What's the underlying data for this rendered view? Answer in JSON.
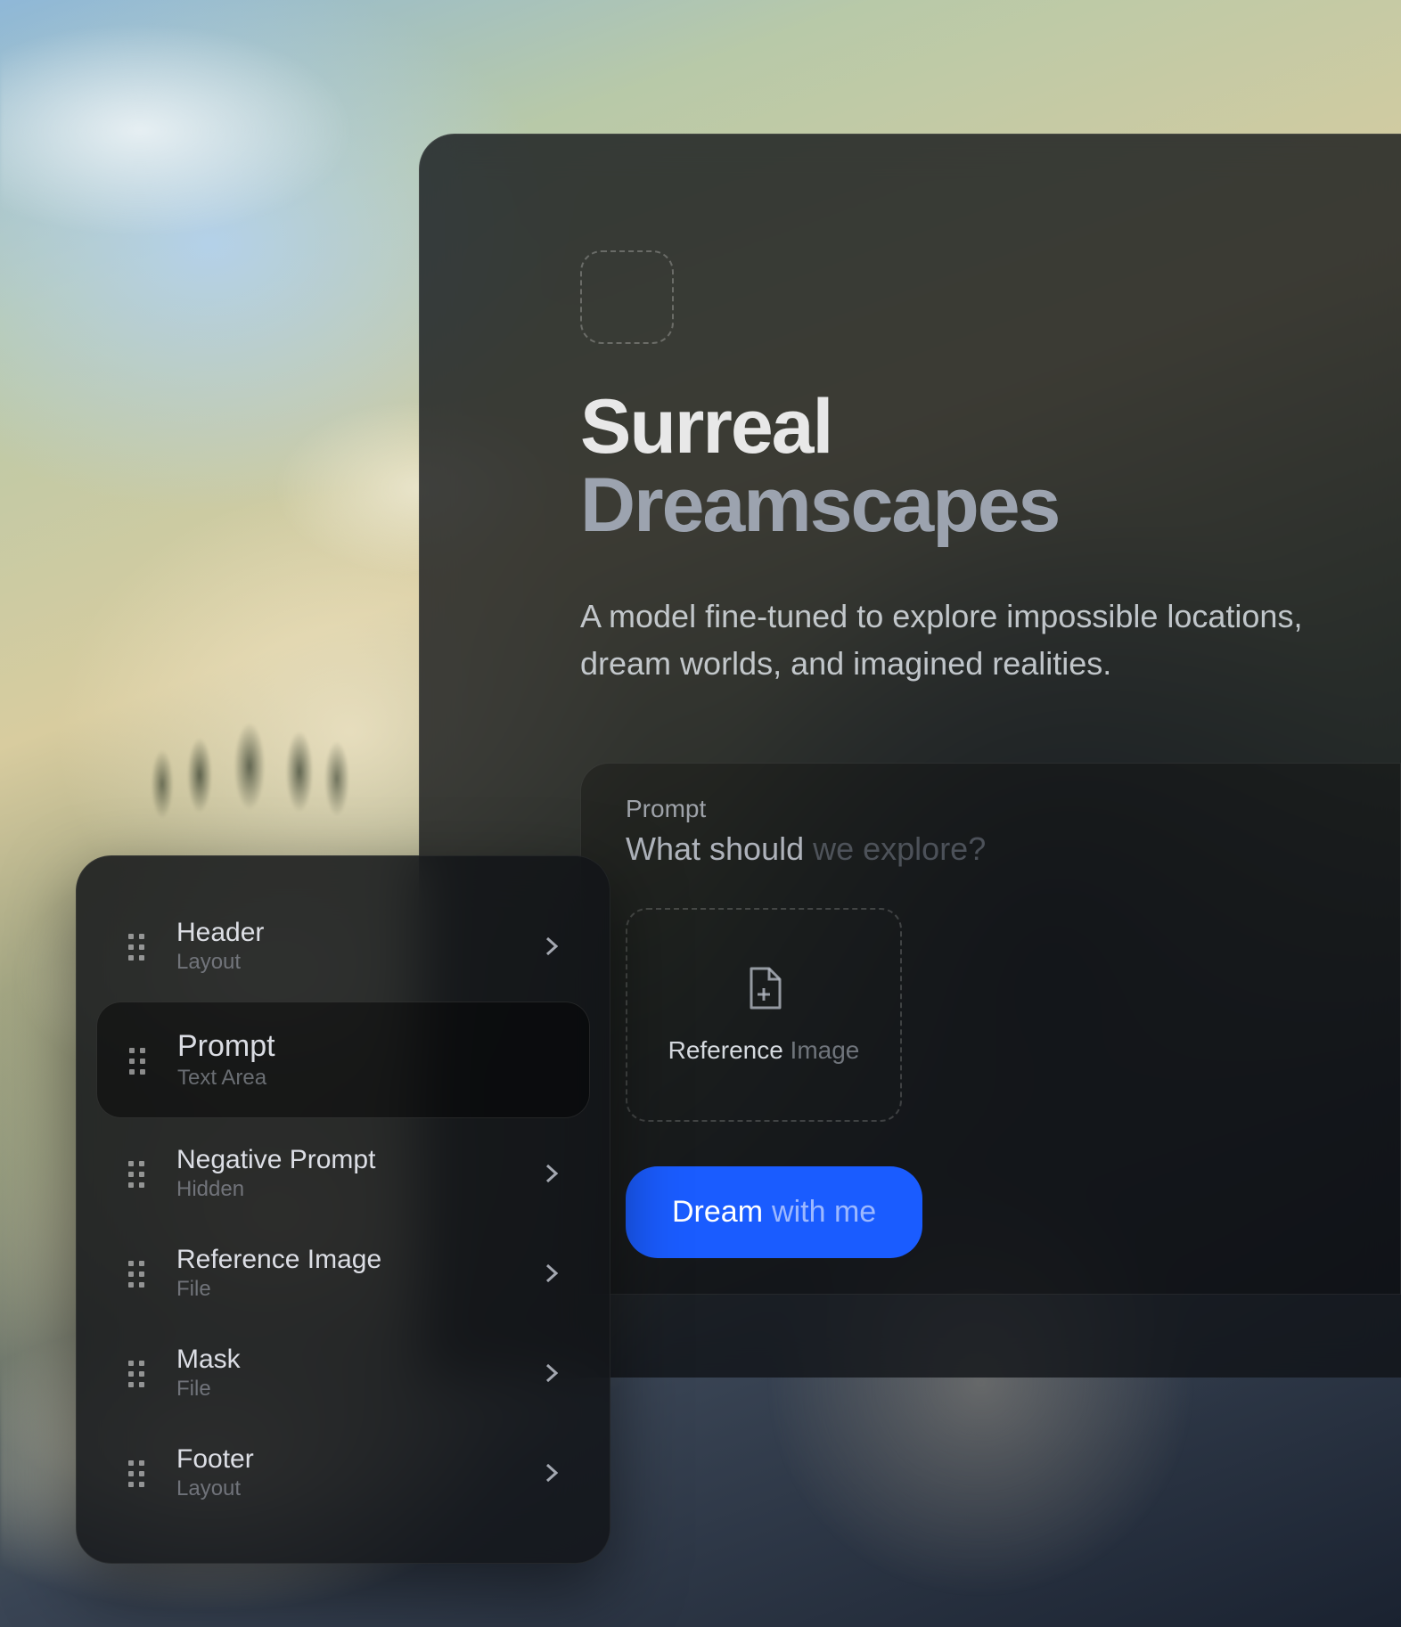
{
  "header": {
    "title_line1": "Surreal",
    "title_line2": "Dreamscapes",
    "description": "A model fine-tuned to explore impossible locations, dream worlds, and imagined realities."
  },
  "prompt": {
    "label": "Prompt",
    "placeholder_bright": "What should",
    "placeholder_dim": " we explore?"
  },
  "reference": {
    "label_bright": "Reference",
    "label_dim": " Image"
  },
  "button": {
    "bright": "Dream",
    "dim": "with me"
  },
  "sidebar": {
    "items": [
      {
        "title": "Header",
        "subtitle": "Layout",
        "active": false
      },
      {
        "title": "Prompt",
        "subtitle": "Text Area",
        "active": true
      },
      {
        "title": "Negative Prompt",
        "subtitle": "Hidden",
        "active": false
      },
      {
        "title": "Reference Image",
        "subtitle": "File",
        "active": false
      },
      {
        "title": "Mask",
        "subtitle": "File",
        "active": false
      },
      {
        "title": "Footer",
        "subtitle": "Layout",
        "active": false
      }
    ]
  }
}
